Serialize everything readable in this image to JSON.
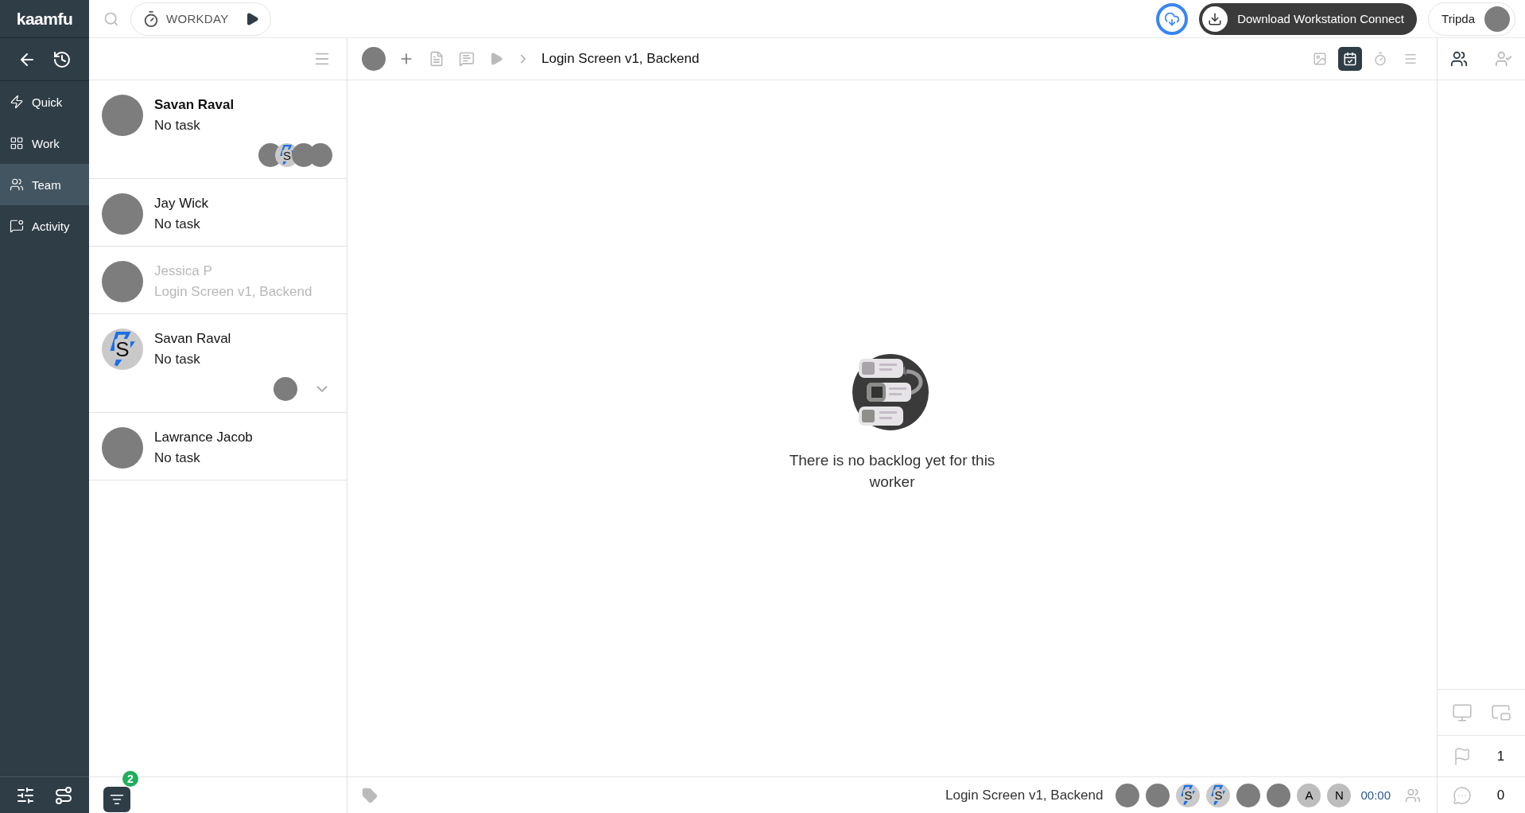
{
  "app": {
    "logo": "kaamfu"
  },
  "top_bar": {
    "timer_label": "WORKDAY",
    "download_button": "Download Workstation Connect",
    "user": {
      "name": "Tripda",
      "avatar": {
        "kind": "photo"
      }
    }
  },
  "nav": {
    "items": [
      {
        "label": "Quick",
        "selected": false
      },
      {
        "label": "Work",
        "selected": false
      },
      {
        "label": "Team",
        "selected": true
      },
      {
        "label": "Activity",
        "selected": false
      }
    ]
  },
  "members": [
    {
      "name": "Savan Raval",
      "task": "No task",
      "selected": true,
      "dimmed": false,
      "avatar": {
        "kind": "photo"
      },
      "watchers": [
        {
          "kind": "photo"
        },
        {
          "kind": "bolt",
          "letter": "S"
        },
        {
          "kind": "photo"
        },
        {
          "kind": "photo"
        }
      ],
      "expandable": false
    },
    {
      "name": "Jay Wick",
      "task": "No task",
      "selected": false,
      "dimmed": false,
      "avatar": {
        "kind": "photo"
      },
      "expandable": false
    },
    {
      "name": "Jessica P",
      "task": "Login Screen v1, Backend",
      "selected": false,
      "dimmed": true,
      "avatar": {
        "kind": "photo"
      },
      "expandable": false
    },
    {
      "name": "Savan Raval",
      "task": "No task",
      "selected": false,
      "dimmed": false,
      "avatar": {
        "kind": "bolt",
        "letter": "S"
      },
      "watchers": [
        {
          "kind": "photo"
        }
      ],
      "expandable": true
    },
    {
      "name": "Lawrance Jacob",
      "task": "No task",
      "selected": false,
      "dimmed": false,
      "avatar": {
        "kind": "photo"
      },
      "expandable": false
    }
  ],
  "filter": {
    "badge": "2"
  },
  "task_bar": {
    "title": "Login Screen v1, Backend",
    "tools": [
      {
        "selected": false
      },
      {
        "selected": true
      },
      {
        "selected": false
      },
      {
        "selected": false
      }
    ]
  },
  "empty_state": {
    "message": "There is no backlog yet for this worker"
  },
  "footer": {
    "task": "Login Screen v1, Backend",
    "participants": [
      {
        "kind": "photo"
      },
      {
        "kind": "photo"
      },
      {
        "kind": "bolt",
        "letter": "S"
      },
      {
        "kind": "bolt",
        "letter": "S"
      },
      {
        "kind": "photo"
      },
      {
        "kind": "photo"
      },
      {
        "kind": "letter",
        "letter": "A"
      },
      {
        "kind": "letter",
        "letter": "N"
      }
    ],
    "time": "00:00"
  },
  "side_panel": {
    "tabs": [
      {
        "selected": true
      },
      {
        "selected": false
      }
    ],
    "flags": "1",
    "comments": "0"
  }
}
